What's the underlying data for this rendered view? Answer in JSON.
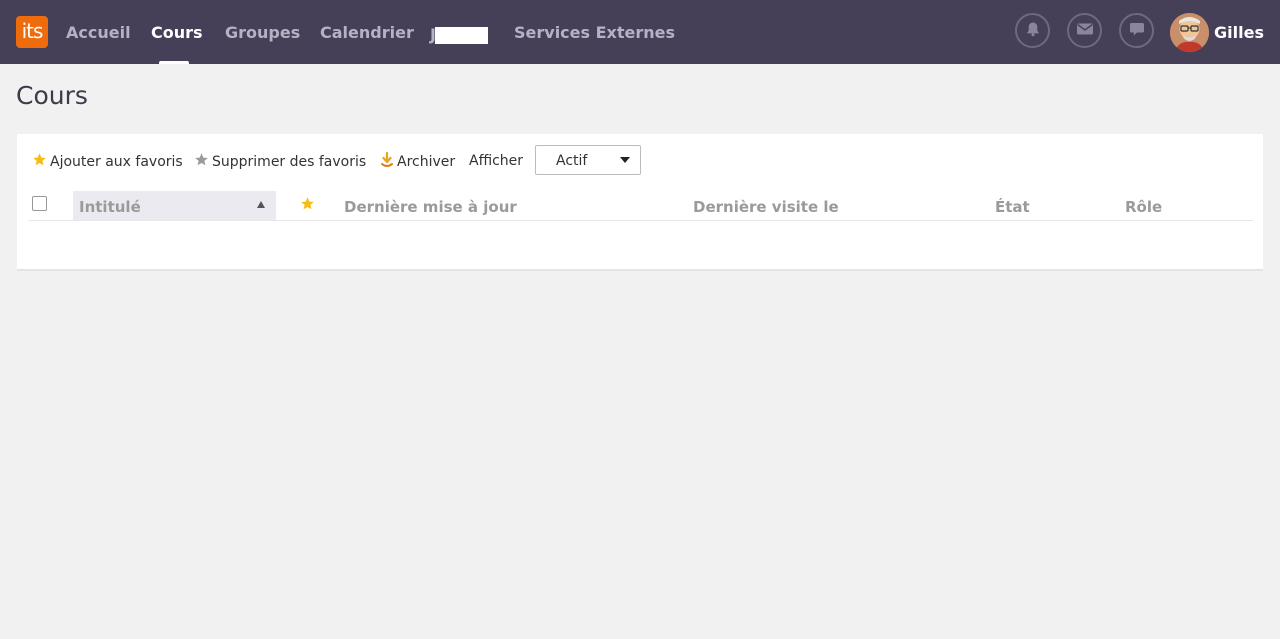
{
  "header": {
    "logo_text": "its",
    "nav": [
      {
        "label": "Accueil"
      },
      {
        "label": "Cours"
      },
      {
        "label": "Groupes"
      },
      {
        "label": "Calendrier"
      },
      {
        "label": "J"
      },
      {
        "label": "Services Externes"
      }
    ],
    "active_nav": "Cours",
    "user": {
      "name": "Gilles"
    },
    "icons": [
      "bell-icon",
      "envelope-icon",
      "chat-icon"
    ]
  },
  "page": {
    "title": "Cours"
  },
  "toolbar": {
    "add_favorites": "Ajouter aux favoris",
    "remove_favorites": "Supprimer des favoris",
    "archive": "Archiver",
    "show_label": "Afficher",
    "show_value": "Actif"
  },
  "table": {
    "columns": {
      "title": "Intitulé",
      "last_update": "Dernière mise à jour",
      "last_visit": "Dernière visite le",
      "state": "État",
      "role": "Rôle"
    },
    "rows": []
  },
  "colors": {
    "topbar": "#453f57",
    "logo": "#ee6c0c",
    "star_gold": "#f3bd16",
    "star_grey": "#9a9a9a",
    "background": "#f1f1f1"
  }
}
